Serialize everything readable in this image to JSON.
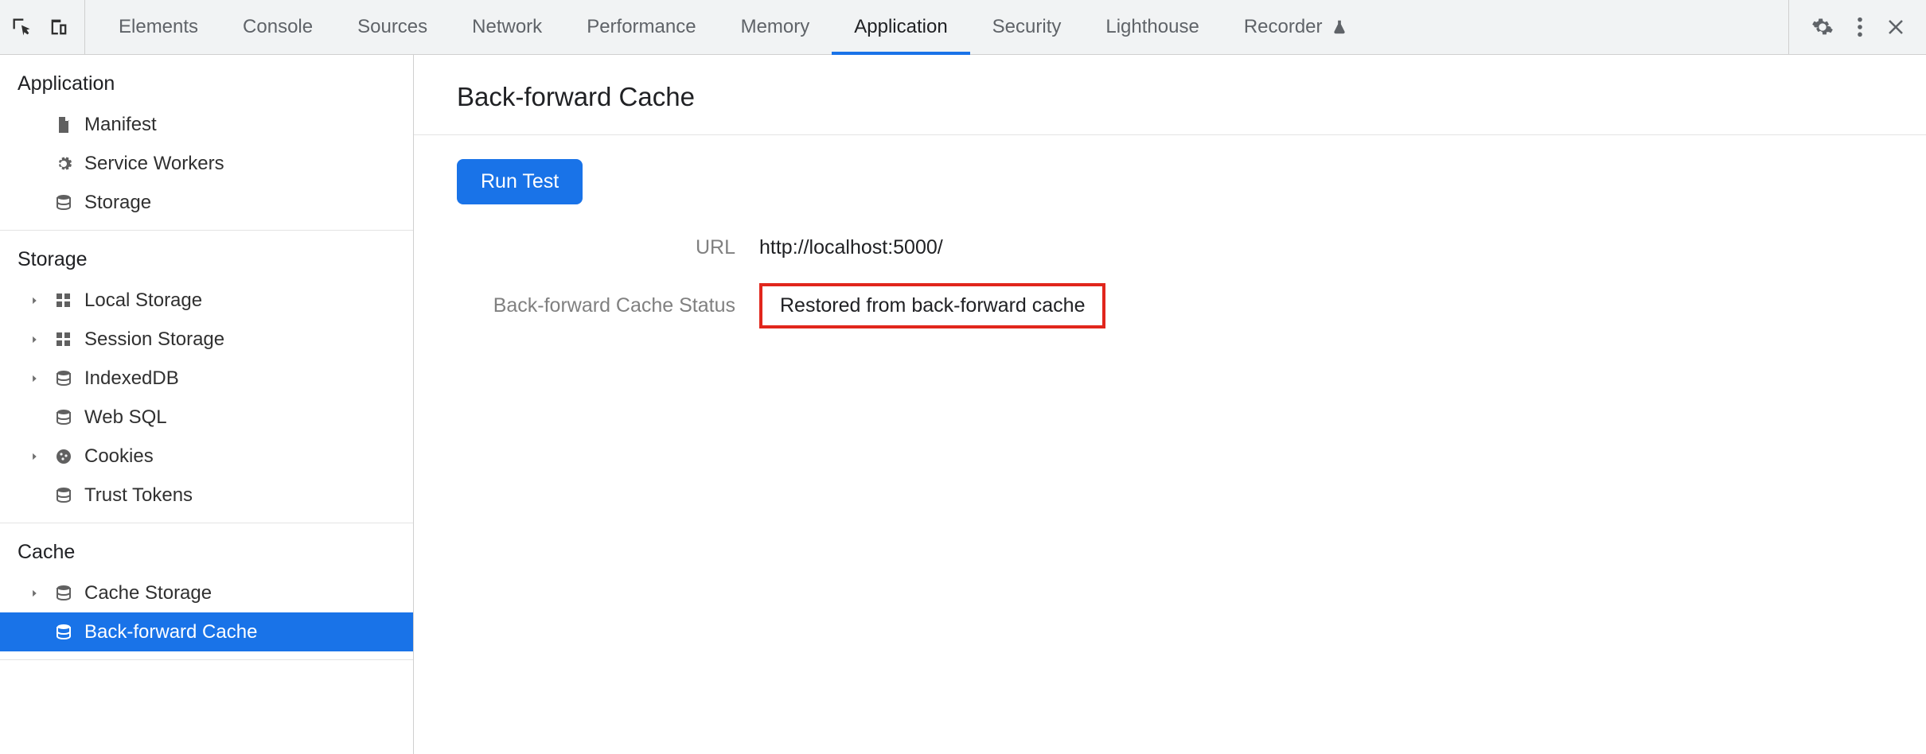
{
  "tabs": [
    {
      "label": "Elements",
      "active": false
    },
    {
      "label": "Console",
      "active": false
    },
    {
      "label": "Sources",
      "active": false
    },
    {
      "label": "Network",
      "active": false
    },
    {
      "label": "Performance",
      "active": false
    },
    {
      "label": "Memory",
      "active": false
    },
    {
      "label": "Application",
      "active": true
    },
    {
      "label": "Security",
      "active": false
    },
    {
      "label": "Lighthouse",
      "active": false
    },
    {
      "label": "Recorder",
      "active": false,
      "badge": "flask"
    }
  ],
  "sidebar": {
    "sections": [
      {
        "heading": "Application",
        "items": [
          {
            "label": "Manifest",
            "icon": "file",
            "expandable": false
          },
          {
            "label": "Service Workers",
            "icon": "gear",
            "expandable": false
          },
          {
            "label": "Storage",
            "icon": "db",
            "expandable": false
          }
        ]
      },
      {
        "heading": "Storage",
        "items": [
          {
            "label": "Local Storage",
            "icon": "grid",
            "expandable": true
          },
          {
            "label": "Session Storage",
            "icon": "grid",
            "expandable": true
          },
          {
            "label": "IndexedDB",
            "icon": "db",
            "expandable": true
          },
          {
            "label": "Web SQL",
            "icon": "db",
            "expandable": false
          },
          {
            "label": "Cookies",
            "icon": "cookie",
            "expandable": true
          },
          {
            "label": "Trust Tokens",
            "icon": "db",
            "expandable": false
          }
        ]
      },
      {
        "heading": "Cache",
        "items": [
          {
            "label": "Cache Storage",
            "icon": "db",
            "expandable": true
          },
          {
            "label": "Back-forward Cache",
            "icon": "db",
            "expandable": false,
            "selected": true
          }
        ]
      }
    ]
  },
  "content": {
    "title": "Back-forward Cache",
    "runLabel": "Run Test",
    "rows": [
      {
        "label": "URL",
        "value": "http://localhost:5000/",
        "highlight": false
      },
      {
        "label": "Back-forward Cache Status",
        "value": "Restored from back-forward cache",
        "highlight": true
      }
    ]
  }
}
